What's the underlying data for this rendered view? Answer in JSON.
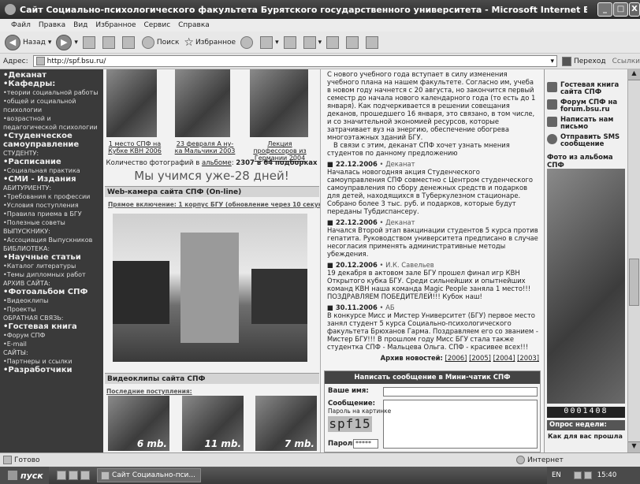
{
  "window": {
    "title": "Сайт Социально-психологического факультета Бурятского государственного университета - Microsoft Internet Explorer",
    "minimize": "_",
    "maximize": "□",
    "close": "X"
  },
  "menu": [
    "Файл",
    "Правка",
    "Вид",
    "Избранное",
    "Сервис",
    "Справка"
  ],
  "toolbar": {
    "back": "Назад",
    "search": "Поиск",
    "favorites": "Избранное"
  },
  "address": {
    "label": "Адрес:",
    "url": "http://spf.bsu.ru/",
    "go": "Переход",
    "links": "Ссылки"
  },
  "leftnav": [
    {
      "text": "•Деканат",
      "style": "bold"
    },
    {
      "text": "•Кафедры:",
      "style": "bold"
    },
    {
      "text": "•теории социальной работы",
      "style": "small"
    },
    {
      "text": "•общей и социальной психологии",
      "style": "small"
    },
    {
      "text": "•возрастной и педагогической психологии",
      "style": "small"
    },
    {
      "text": "•Студенческое самоуправление",
      "style": "bold"
    },
    {
      "text": "СТУДЕНТУ:",
      "style": "small"
    },
    {
      "text": "•Расписание",
      "style": "bold"
    },
    {
      "text": "•Социальная практика",
      "style": "small"
    },
    {
      "text": "•СМИ - Издания",
      "style": "bold"
    },
    {
      "text": "АБИТУРИЕНТУ:",
      "style": "small"
    },
    {
      "text": "•Требования к профессии",
      "style": "small"
    },
    {
      "text": "•Условия поступления",
      "style": "small"
    },
    {
      "text": "•Правила приема в БГУ",
      "style": "small"
    },
    {
      "text": "•Полезные советы",
      "style": "small"
    },
    {
      "text": "ВЫПУСКНИКУ:",
      "style": "small"
    },
    {
      "text": "•Ассоциация Выпускников",
      "style": "small"
    },
    {
      "text": "БИБЛИОТЕКА:",
      "style": "small"
    },
    {
      "text": "•Научные статьи",
      "style": "bold"
    },
    {
      "text": "•Каталог литературы",
      "style": "small"
    },
    {
      "text": "•Темы дипломных работ",
      "style": "small"
    },
    {
      "text": "АРХИВ САЙТА:",
      "style": "small"
    },
    {
      "text": "•Фотоальбом СПФ",
      "style": "bold"
    },
    {
      "text": "•Видеоклипы",
      "style": "small"
    },
    {
      "text": "•Проекты",
      "style": "small"
    },
    {
      "text": "ОБРАТНАЯ СВЯЗЬ:",
      "style": "small"
    },
    {
      "text": "•Гостевая книга",
      "style": "bold"
    },
    {
      "text": "•Форум СПФ",
      "style": "small"
    },
    {
      "text": "•E-mail",
      "style": "small"
    },
    {
      "text": "САЙТЫ:",
      "style": "small"
    },
    {
      "text": "•Партнеры и ссылки",
      "style": "small"
    },
    {
      "text": "•Разработчики",
      "style": "bold"
    }
  ],
  "photos": {
    "captions": [
      "1 место СПФ на Кубке КВН 2006",
      "23 февраля А ну-ка Мальчики 2003",
      "Лекция профессоров из Германии 2004"
    ],
    "count_prefix": "Количество фотографий в",
    "count_link": "альбоме",
    "count_value": "2307 в 64 подборках",
    "slogan": "Мы учимся уже-28 дней!"
  },
  "webcam": {
    "heading": "Web-камера сайта СПФ (On-line)",
    "subtitle": "Прямое включение: 1 корпус БГУ (обновление через 10 секунд)"
  },
  "videos": {
    "heading": "Видеоклипы сайта СПФ",
    "subtitle": "Последние поступления:",
    "sizes": [
      "6 mb.",
      "11 mb.",
      "7 mb."
    ]
  },
  "news": {
    "intro": "С нового учебного года вступает в силу изменения учебного плана на нашем факультете. Согласно им, учеба в новом году начнется с 20 августа, но закончится первый семестр до начала нового календарного года (то есть до 1 января). Как подчеркивается в решении совещания деканов, прошедшего 16 января, это связано, в том числе, и со значительной экономией ресурсов, которые затрачивает вуз на энергию, обеспечение обогрева многоэтажных зданий БГУ.",
    "intro2": "В связи с этим, деканат СПФ хочет узнать мнения студентов по данному предложению",
    "items": [
      {
        "date": "22.12.2006",
        "src": "Деканат",
        "text": "Началась новогодняя акция Студенческого самоуправления СПФ совместно с Центром студенческого самоуправления по сбору денежных средств и подарков для детей, находящихся в Туберкулезном стационаре. Собрано более 3 тыс. руб. и подарков, которые будут переданы Тубдиспансеру."
      },
      {
        "date": "22.12.2006",
        "src": "Деканат",
        "text": "Начался Второй этап вакцинации студентов 5 курса против гепатита. Руководством университета предписано в случае несогласия применять административные методы убеждения."
      },
      {
        "date": "20.12.2006",
        "src": "И.К. Савельев",
        "text": "19 декабря в актовом зале БГУ прошел финал игр КВН Открытого кубка БГУ. Среди сильнейших и опытнейших команд КВН наша команда Magic People заняла 1 место!!! ПОЗДРАВЛЯЕМ ПОБЕДИТЕЛЕЙ!!! Кубок наш!"
      },
      {
        "date": "30.11.2006",
        "src": "АБ",
        "text": "В конкурсе Мисс и Мистер Университет (БГУ) первое место занял студент 5 курса Социально-психологического факультета Брюханов Гарма. Поздравляем его со званием - Мистер БГУ!!! В прошлом году Мисс БГУ стала также студентка СПФ - Мальцева Ольга. СПФ - красивее всех!!!"
      }
    ],
    "archive_label": "Архив новостей:",
    "archive_years": [
      "[2006]",
      "[2005]",
      "[2004]",
      "[2003]"
    ]
  },
  "message_form": {
    "heading": "Написать сообщение в Мини-чатик СПФ",
    "name_label": "Ваше имя:",
    "message_label": "Сообщение:",
    "captcha_hint": "Пароль на картинке",
    "captcha_text": "spf15",
    "password_label": "Пароль:",
    "password_value": "*****"
  },
  "rightcol": {
    "links": [
      "Гостевая книга сайта СПФ",
      "Форум СПФ на forum.bsu.ru",
      "Написать нам письмо",
      "Отправить SMS сообщение"
    ],
    "album_title": "Фото из альбома СПФ",
    "counter": "0001408",
    "poll_title": "Опрос недели:",
    "poll_question": "Как для вас прошла"
  },
  "status": {
    "ready": "Готово",
    "zone": "Интернет"
  },
  "taskbar": {
    "start": "пуск",
    "window": "Сайт Социально-пси...",
    "lang": "EN",
    "clock": "15:40"
  }
}
